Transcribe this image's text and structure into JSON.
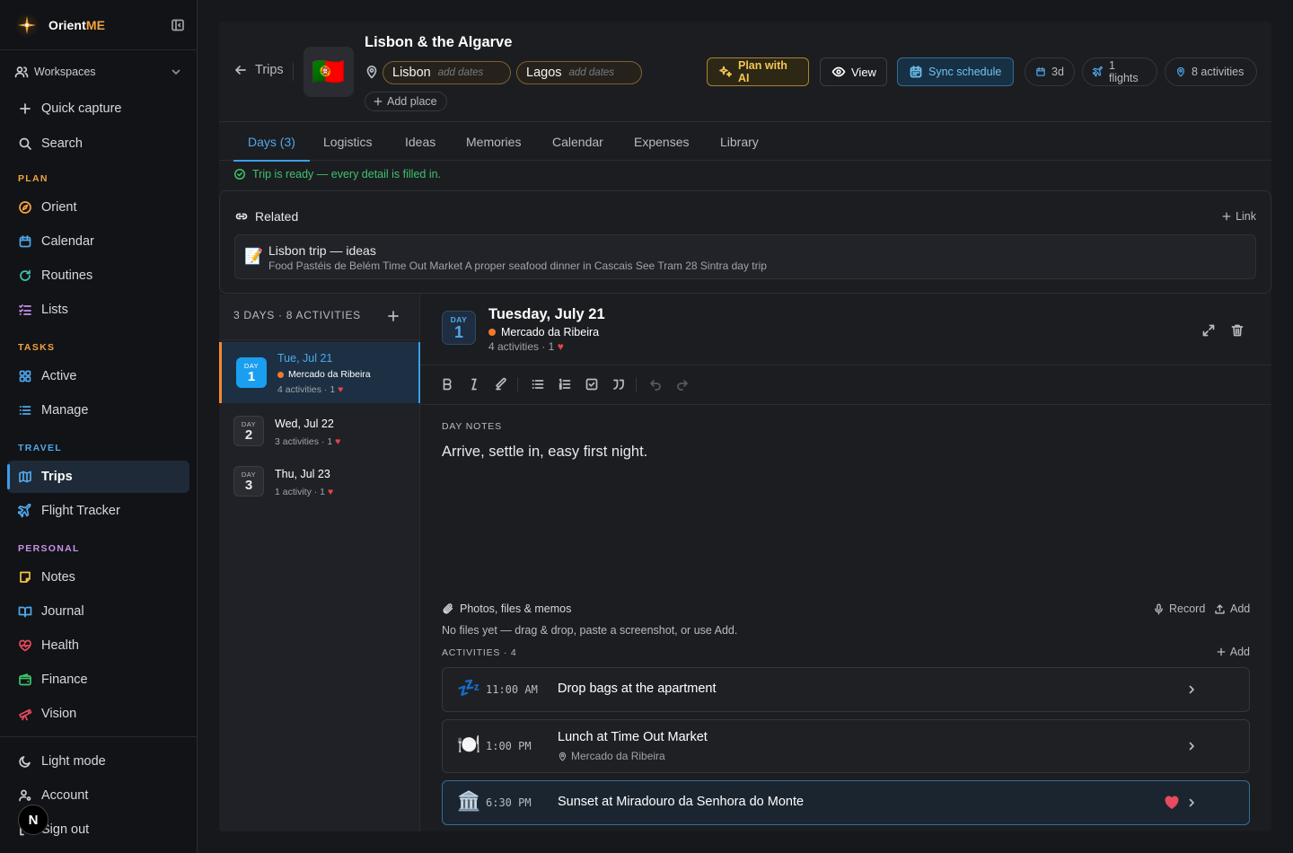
{
  "brand": {
    "name_a": "Orient",
    "name_b": "ME"
  },
  "sidebar": {
    "workspace": "Workspaces",
    "quick_capture": "Quick capture",
    "search": "Search",
    "sections": {
      "plan": "PLAN",
      "tasks": "TASKS",
      "travel": "TRAVEL",
      "personal": "PERSONAL"
    },
    "plan_items": [
      "Orient",
      "Calendar",
      "Routines",
      "Lists"
    ],
    "task_items": [
      "Active",
      "Manage"
    ],
    "travel_items": [
      "Trips",
      "Flight Tracker"
    ],
    "personal_items": [
      "Notes",
      "Journal",
      "Health",
      "Finance",
      "Vision"
    ],
    "footer_items": [
      "Light mode",
      "Account",
      "Sign out"
    ],
    "avatar_letter": "N",
    "active_item": "Trips",
    "colors": {
      "section": "#f4a340",
      "section_travel": "#4fa8ec",
      "section_personal": "#c792ea"
    }
  },
  "trip": {
    "back_label": "Trips",
    "flag": "🇵🇹",
    "title": "Lisbon & the Algarve",
    "places": [
      {
        "name": "Lisbon",
        "dates": "add dates"
      },
      {
        "name": "Lagos",
        "dates": "add dates"
      }
    ],
    "add_place": "Add place",
    "buttons": {
      "plan_ai": "Plan with AI",
      "view": "View",
      "sync": "Sync schedule"
    },
    "pills": {
      "days": "3d",
      "flights": "1 flights",
      "activities": "8 activities"
    }
  },
  "tabs": [
    "Days (3)",
    "Logistics",
    "Ideas",
    "Memories",
    "Calendar",
    "Expenses",
    "Library"
  ],
  "active_tab": "Days (3)",
  "status": "Trip is ready — every detail is filled in.",
  "related": {
    "title": "Related",
    "link_label": "Link",
    "card": {
      "emoji": "📝",
      "title": "Lisbon trip — ideas",
      "subtitle": "Food Pastéis de Belém Time Out Market A proper seafood dinner in Cascais See Tram 28 Sintra day trip"
    }
  },
  "days_panel": {
    "header": "3 DAYS · 8 ACTIVITIES",
    "days": [
      {
        "badge": "DAY",
        "num": "1",
        "name": "Tue, Jul 21",
        "location": "Mercado da Ribeira",
        "meta": "4 activities · 1",
        "heart": "♥"
      },
      {
        "badge": "DAY",
        "num": "2",
        "name": "Wed, Jul 22",
        "meta": "3 activities · 1",
        "heart": "♥"
      },
      {
        "badge": "DAY",
        "num": "3",
        "name": "Thu, Jul 23",
        "meta": "1 activity · 1",
        "heart": "♥"
      }
    ]
  },
  "day_detail": {
    "badge": "DAY",
    "num": "1",
    "title": "Tuesday, July 21",
    "location": "Mercado da Ribeira",
    "meta": "4 activities · 1",
    "heart": "♥",
    "notes_header": "DAY NOTES",
    "notes": "Arrive, settle in, easy first night.",
    "files_header": "Photos, files & memos",
    "record_label": "Record",
    "add_label": "Add",
    "files_empty": "No files yet — drag & drop, paste a screenshot, or use Add.",
    "activities_header": "ACTIVITIES · 4",
    "activities_add": "Add",
    "activities": [
      {
        "emoji": "💤",
        "time": "11:00 AM",
        "name": "Drop bags at the apartment"
      },
      {
        "emoji": "🍽️",
        "time": "1:00 PM",
        "name": "Lunch at Time Out Market",
        "location": "Mercado da Ribeira"
      },
      {
        "emoji": "🏛️",
        "time": "6:30 PM",
        "name": "Sunset at Miradouro da Senhora do Monte",
        "favorite": true
      }
    ]
  }
}
